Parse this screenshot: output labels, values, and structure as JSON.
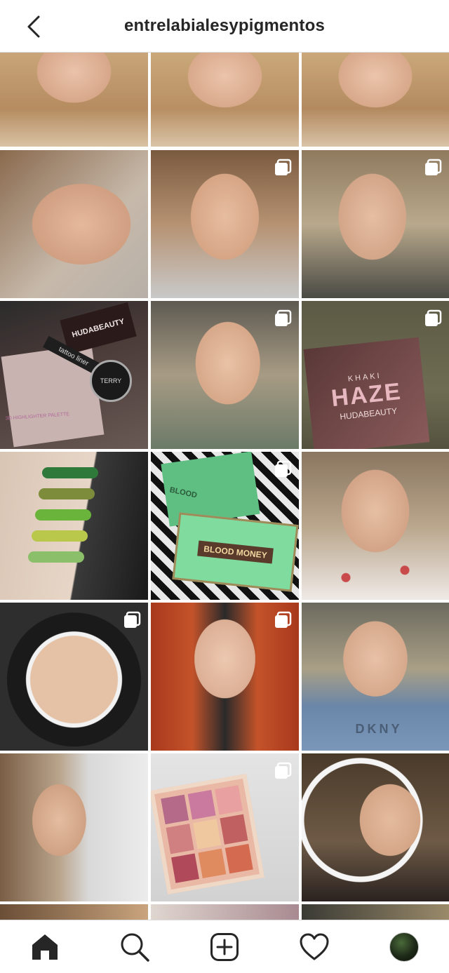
{
  "header": {
    "username": "entrelabialesypigmentos"
  },
  "icons": {
    "back": "chevron-left-icon",
    "multi": "multiple-photos-icon"
  },
  "posts": [
    {
      "id": "p1",
      "multi": false,
      "art": "face-blue-eyes"
    },
    {
      "id": "p2",
      "multi": false,
      "art": "face-closeup"
    },
    {
      "id": "p3",
      "multi": false,
      "art": "face-closeup-2"
    },
    {
      "id": "p4",
      "multi": false,
      "art": "face-tilted"
    },
    {
      "id": "p5",
      "multi": true,
      "art": "face-smokey"
    },
    {
      "id": "p6",
      "multi": true,
      "art": "face-green-eyes"
    },
    {
      "id": "p7",
      "multi": false,
      "art": "huda-products",
      "texts": [
        "HUDABEAUTY",
        "tattoo liner",
        "TERRY",
        "3D HIGHLIGHTER PALETTE"
      ]
    },
    {
      "id": "p8",
      "multi": true,
      "art": "face-green-shadow"
    },
    {
      "id": "p9",
      "multi": true,
      "art": "haze-palette",
      "texts": [
        "KHAKI",
        "HAZE",
        "HUDABEAUTY"
      ]
    },
    {
      "id": "p10",
      "multi": false,
      "art": "green-swatches"
    },
    {
      "id": "p11",
      "multi": true,
      "art": "blood-money",
      "texts": [
        "BLOOD",
        "BLOOD MONEY"
      ]
    },
    {
      "id": "p12",
      "multi": false,
      "art": "face-teal-liner"
    },
    {
      "id": "p13",
      "multi": true,
      "art": "ring-light-face"
    },
    {
      "id": "p14",
      "multi": true,
      "art": "red-hair-face"
    },
    {
      "id": "p15",
      "multi": false,
      "art": "face-dkny",
      "texts": [
        "DKNY"
      ]
    },
    {
      "id": "p16",
      "multi": false,
      "art": "face-veil"
    },
    {
      "id": "p17",
      "multi": true,
      "art": "rose-palette"
    },
    {
      "id": "p18",
      "multi": false,
      "art": "face-red-lips"
    }
  ],
  "bottom_nav": [
    "home-icon",
    "search-icon",
    "new-post-icon",
    "activity-heart-icon",
    "profile-avatar"
  ],
  "colors": {
    "text": "#262626",
    "divider": "#dbdbdb",
    "background": "#ffffff"
  }
}
